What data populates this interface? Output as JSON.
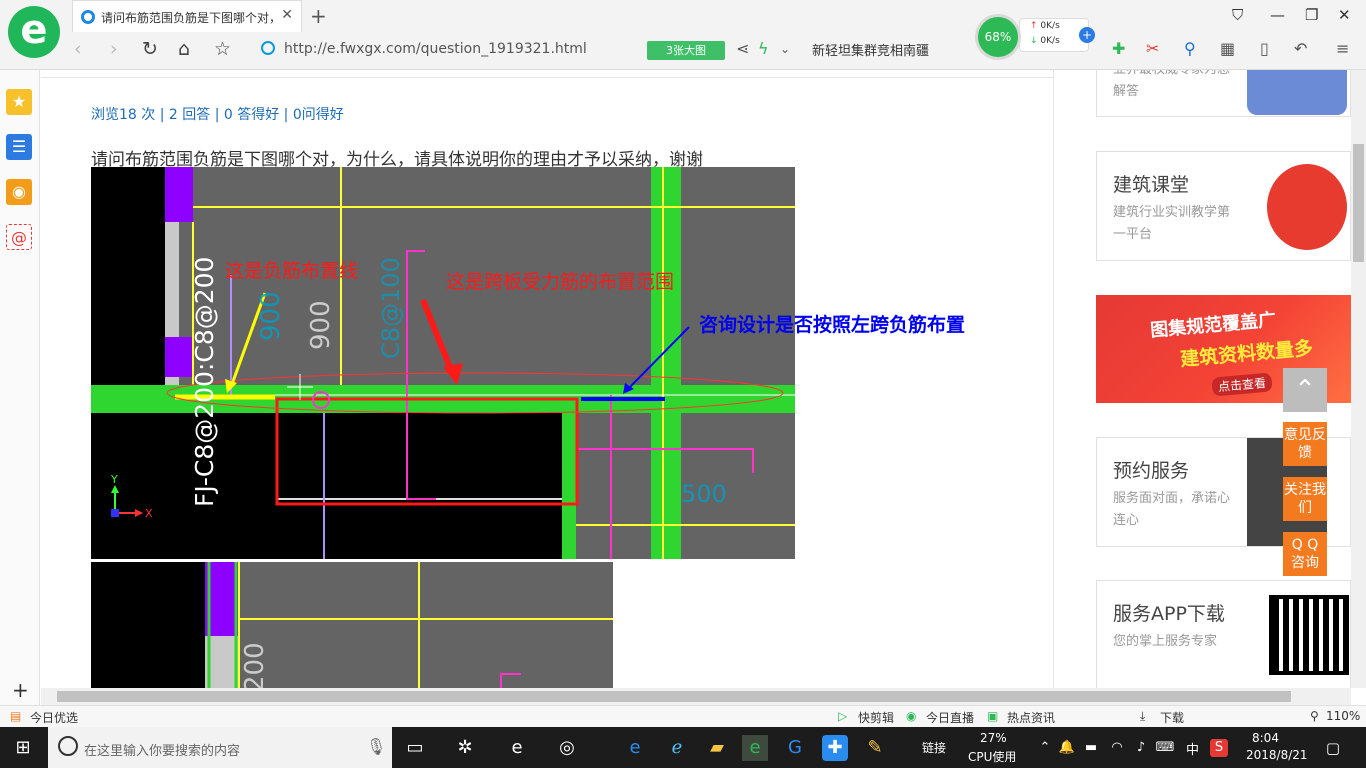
{
  "browser": {
    "tab_title": "请问布筋范围负筋是下图哪个对，为什么，请具体说明你的理由才予以采纳，谢谢",
    "url": "http://e.fwxgx.com/question_1919321.html",
    "image_button": "3张大图",
    "search_text": "新轻坦集群竞相南疆",
    "speed": {
      "percent": "68%",
      "up": "0K/s",
      "down": "0K/s"
    }
  },
  "page": {
    "stats": "浏览18 次 | 2 回答 | 0 答得好 | 0问得好",
    "question": "请问布筋范围负筋是下图哪个对，为什么，请具体说明你的理由才予以采纳，谢谢"
  },
  "cad": {
    "annotation_yellow": "这是负筋布置线",
    "annotation_red": "这是跨板受力筋的布置范围",
    "annotation_blue": "咨询设计是否按照左跨负筋布置",
    "rebar_label": "FJ-C8@200:C8@200",
    "dim_900a": "900",
    "dim_900b": "900",
    "dim_gray": "C8@100",
    "dim_500": "500",
    "dim_2200": "200",
    "axis_x": "X",
    "axis_y": "Y"
  },
  "sidebar": {
    "card0_desc": "业界最权威专家为您解答",
    "card1_title": "建筑课堂",
    "card1_desc": "建筑行业实训教学第一平台",
    "promo_line1": "图集规范覆盖广",
    "promo_line2": "建筑资料数量多",
    "promo_cta": "点击查看",
    "card2_title": "预约服务",
    "card2_desc": "服务面对面，承诺心连心",
    "card3_title": "服务APP下载",
    "card3_desc": "您的掌上服务专家"
  },
  "float": {
    "feedback": "意见反馈",
    "follow": "关注我们",
    "qq": "Q Q 咨询"
  },
  "statusbar": {
    "left": "今日优选",
    "kuaijianji": "快剪辑",
    "zhibo": "今日直播",
    "news": "热点资讯",
    "download": "下载",
    "zoom": "110%"
  },
  "taskbar": {
    "search_placeholder": "在这里输入你要搜索的内容",
    "links": "链接",
    "cpu": "27%",
    "cpu_label": "CPU使用",
    "ime": "中",
    "time": "8:04",
    "date": "2018/8/21"
  }
}
